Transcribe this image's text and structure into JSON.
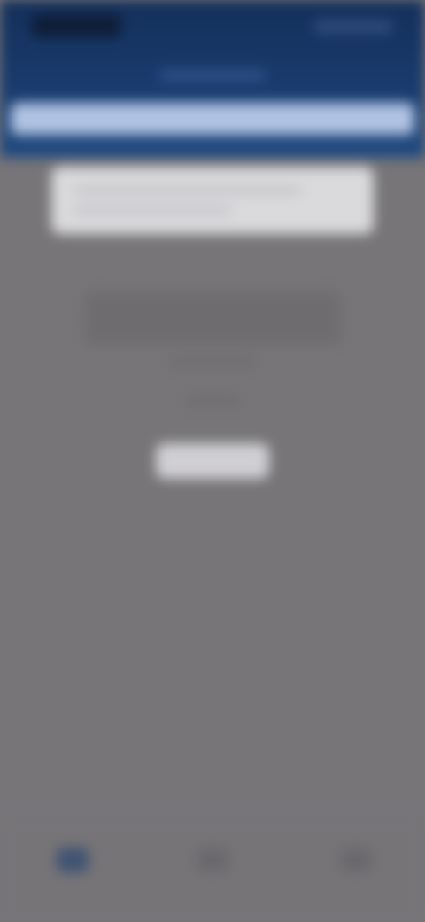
{
  "header": {
    "status_time": "",
    "status_icons": "",
    "title": ""
  },
  "search": {
    "placeholder": ""
  },
  "card": {
    "text": ""
  },
  "message": {
    "title": "",
    "subtitle": "",
    "detail": ""
  },
  "action": {
    "label": ""
  },
  "bottom_nav": {
    "items": [
      {
        "label": "",
        "icon": "home-icon"
      },
      {
        "label": "",
        "icon": "menu-icon"
      },
      {
        "label": "",
        "icon": "profile-icon"
      }
    ]
  },
  "colors": {
    "header_bg": "#153a70",
    "search_bg": "#b9cdf0",
    "page_bg": "#7b797c",
    "card_bg": "#e6e5e8",
    "button_bg": "#dcdbdf"
  }
}
